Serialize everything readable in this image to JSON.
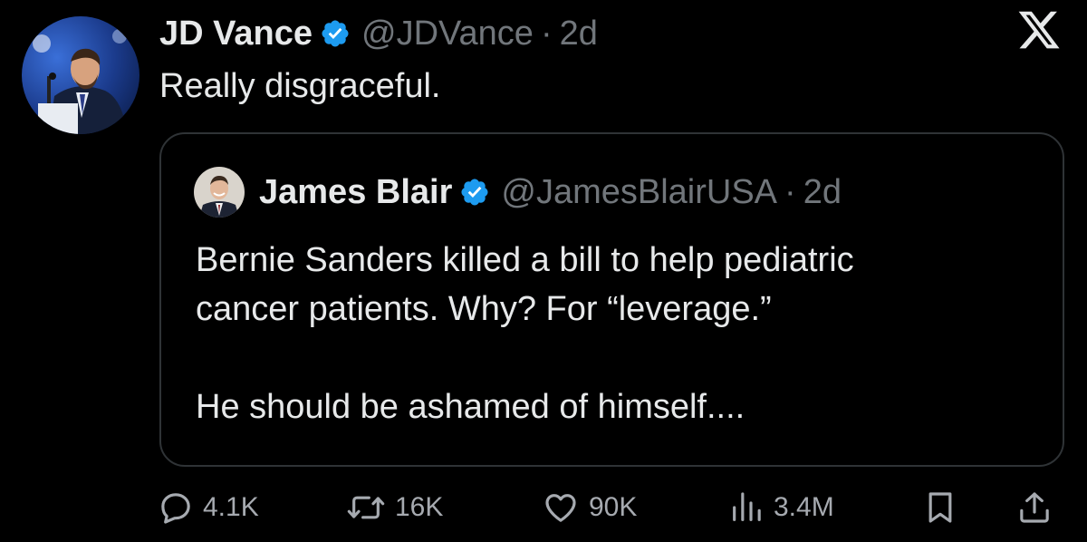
{
  "post": {
    "author_name": "JD Vance",
    "author_handle": "@JDVance",
    "separator": "·",
    "time": "2d",
    "text": "Really disgraceful.",
    "verified": true
  },
  "quoted_post": {
    "author_name": "James Blair",
    "author_handle": "@JamesBlairUSA",
    "separator": "·",
    "time": "2d",
    "verified": true,
    "lines": [
      "Bernie Sanders killed a bill to help pediatric",
      "cancer patients.  Why?  For “leverage.”",
      "He should be ashamed of himself...."
    ]
  },
  "actions": {
    "replies": "4.1K",
    "reposts": "16K",
    "likes": "90K",
    "views": "3.4M"
  },
  "icons": {
    "app_logo": "x-logo-icon",
    "verified": "verified-badge-icon",
    "reply": "reply-icon",
    "repost": "repost-icon",
    "like": "heart-icon",
    "views": "views-chart-icon",
    "bookmark": "bookmark-icon",
    "share": "share-icon"
  },
  "colors": {
    "background": "#000000",
    "text": "#e7e9ea",
    "secondary_text": "#71767b",
    "verified_badge": "#1d9bf0",
    "border": "#2f3336"
  }
}
